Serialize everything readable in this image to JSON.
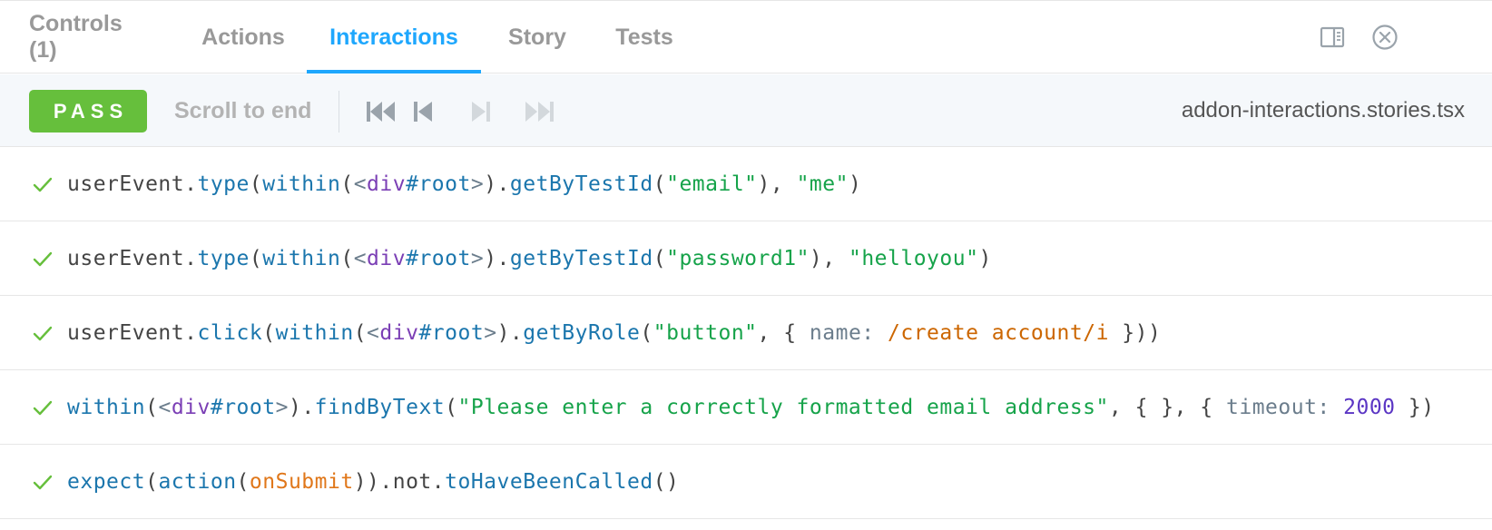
{
  "tabs": [
    {
      "label": "Controls (1)"
    },
    {
      "label": "Actions"
    },
    {
      "label": "Interactions"
    },
    {
      "label": "Story"
    },
    {
      "label": "Tests"
    }
  ],
  "active_tab": "Interactions",
  "toolbar": {
    "status": "PASS",
    "scroll_label": "Scroll to end",
    "file_name": "addon-interactions.stories.tsx",
    "buttons": [
      "go-to-start-icon",
      "step-back-icon",
      "step-forward-icon",
      "go-to-end-icon"
    ]
  },
  "colors": {
    "accent": "#1ea7fd",
    "pass": "#66bf3c",
    "string": "#16a34a",
    "function": "#1b76ad",
    "element": "#7b3fb5"
  },
  "interactions": [
    {
      "status": "pass",
      "parts": {
        "a": "userEvent",
        "b": ".",
        "c": "type",
        "d": "(",
        "e": "within",
        "f": "(",
        "g": "<",
        "h": "div",
        "i": "#root",
        "j": ">",
        "k": ").",
        "l": "getByTestId",
        "m": "(",
        "n": "\"email\"",
        "o": "), ",
        "p": "\"me\"",
        "q": ")"
      }
    },
    {
      "status": "pass",
      "parts": {
        "a": "userEvent",
        "b": ".",
        "c": "type",
        "d": "(",
        "e": "within",
        "f": "(",
        "g": "<",
        "h": "div",
        "i": "#root",
        "j": ">",
        "k": ").",
        "l": "getByTestId",
        "m": "(",
        "n": "\"password1\"",
        "o": "), ",
        "p": "\"helloyou\"",
        "q": ")"
      }
    },
    {
      "status": "pass",
      "parts": {
        "a": "userEvent",
        "b": ".",
        "c": "click",
        "d": "(",
        "e": "within",
        "f": "(",
        "g": "<",
        "h": "div",
        "i": "#root",
        "j": ">",
        "k": ").",
        "l": "getByRole",
        "m": "(",
        "n": "\"button\"",
        "o": ", { ",
        "p": "name: ",
        "q": "/create account/i",
        "r": " }))"
      }
    },
    {
      "status": "pass",
      "parts": {
        "a": "within",
        "b": "(",
        "c": "<",
        "d": "div",
        "e": "#root",
        "f": ">",
        "g": ").",
        "h": "findByText",
        "i": "(",
        "j": "\"Please enter a correctly formatted email address\"",
        "k": ", { }, { ",
        "l": "timeout: ",
        "m": "2000",
        "n": " })"
      }
    },
    {
      "status": "pass",
      "parts": {
        "a": "expect",
        "b": "(",
        "c": "action",
        "d": "(",
        "e": "onSubmit",
        "f": "))",
        "g": ".not.",
        "h": "toHaveBeenCalled",
        "i": "()"
      }
    }
  ]
}
